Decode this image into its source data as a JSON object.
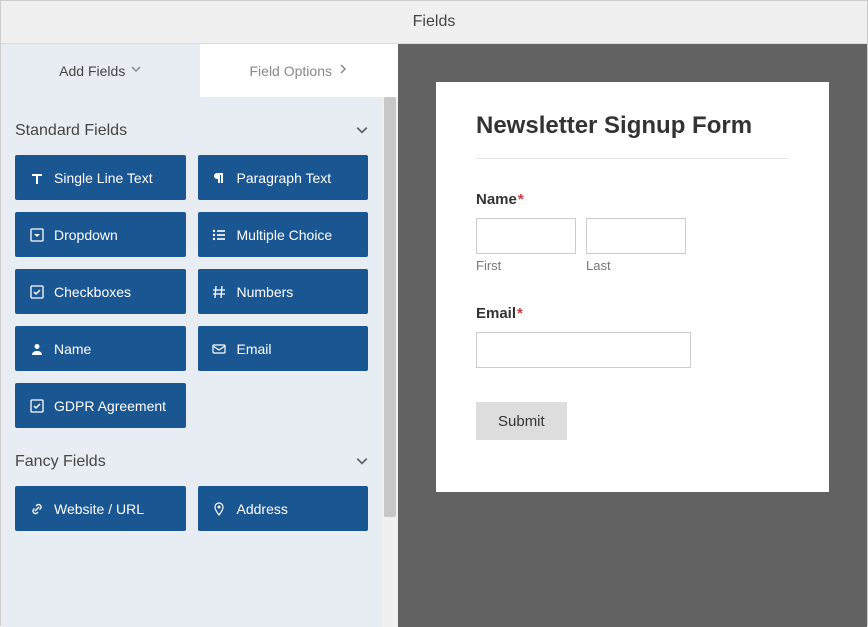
{
  "topbar": {
    "title": "Fields"
  },
  "tabs": {
    "add_fields": "Add Fields",
    "field_options": "Field Options"
  },
  "sections": {
    "standard": {
      "title": "Standard Fields",
      "items": [
        {
          "icon": "text-icon",
          "label": "Single Line Text"
        },
        {
          "icon": "paragraph-icon",
          "label": "Paragraph Text"
        },
        {
          "icon": "caret-square-icon",
          "label": "Dropdown"
        },
        {
          "icon": "list-icon",
          "label": "Multiple Choice"
        },
        {
          "icon": "check-square-icon",
          "label": "Checkboxes"
        },
        {
          "icon": "hash-icon",
          "label": "Numbers"
        },
        {
          "icon": "user-icon",
          "label": "Name"
        },
        {
          "icon": "envelope-icon",
          "label": "Email"
        },
        {
          "icon": "check-square-icon",
          "label": "GDPR Agreement"
        }
      ]
    },
    "fancy": {
      "title": "Fancy Fields",
      "items": [
        {
          "icon": "link-icon",
          "label": "Website / URL"
        },
        {
          "icon": "pin-icon",
          "label": "Address"
        }
      ]
    }
  },
  "form": {
    "title": "Newsletter Signup Form",
    "name": {
      "label": "Name",
      "first_sub": "First",
      "last_sub": "Last"
    },
    "email": {
      "label": "Email"
    },
    "submit": "Submit"
  }
}
